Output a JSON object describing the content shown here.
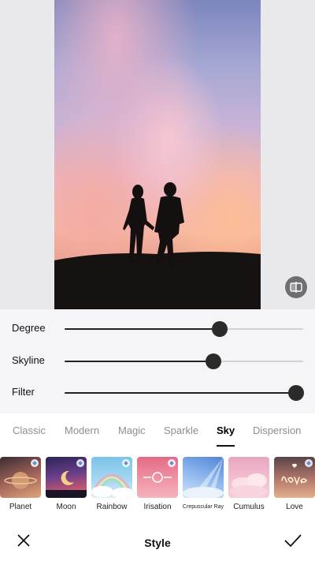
{
  "editor": {
    "sliders": [
      {
        "label": "Degree",
        "value": 0.65
      },
      {
        "label": "Skyline",
        "value": 0.62
      },
      {
        "label": "Filter",
        "value": 0.97
      }
    ],
    "tabs": [
      "Classic",
      "Modern",
      "Magic",
      "Sparkle",
      "Sky",
      "Dispersion"
    ],
    "active_tab": "Sky",
    "thumbnails": [
      {
        "label": "Planet",
        "icon": "planet-thumbnail",
        "premium": true
      },
      {
        "label": "Moon",
        "icon": "moon-thumbnail",
        "premium": true
      },
      {
        "label": "Rainbow",
        "icon": "rainbow-thumbnail",
        "premium": true
      },
      {
        "label": "Irisation",
        "icon": "irisation-thumbnail",
        "premium": true
      },
      {
        "label": "Crepuscular Ray",
        "icon": "crepuscular-ray-thumbnail",
        "premium": false
      },
      {
        "label": "Cumulus",
        "icon": "cumulus-thumbnail",
        "premium": false
      },
      {
        "label": "Love",
        "icon": "love-thumbnail",
        "premium": true
      }
    ],
    "bottom_bar": {
      "title": "Style",
      "cancel_icon": "close-icon",
      "confirm_icon": "checkmark-icon"
    },
    "compare_icon": "compare-icon"
  }
}
